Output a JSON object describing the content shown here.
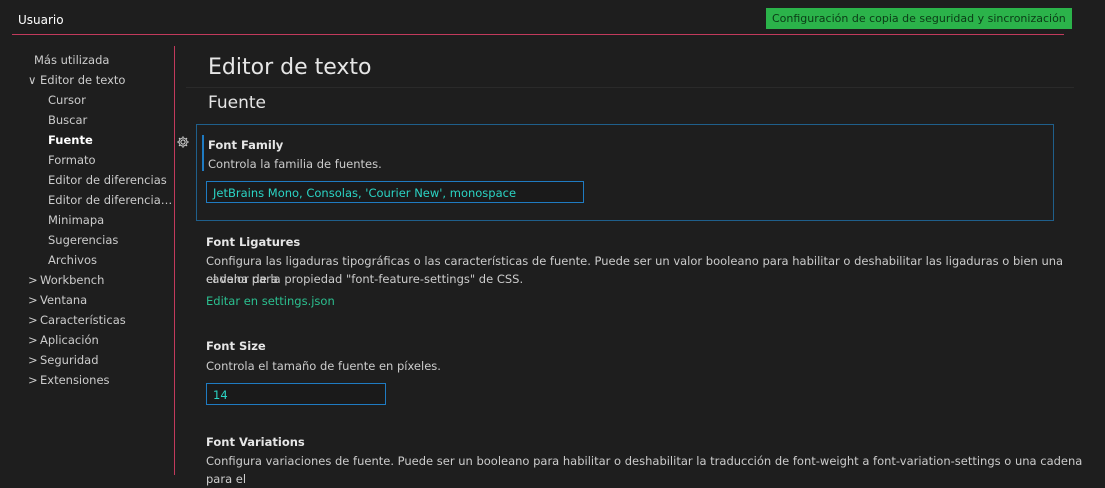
{
  "header": {
    "scope_tab": "Usuario",
    "sync_button": "Configuración de copia de seguridad y sincronización"
  },
  "toc": [
    {
      "label": "Más utilizada",
      "chevron": ""
    },
    {
      "label": "Editor de texto",
      "chevron": "∨"
    },
    {
      "label": "Cursor",
      "chevron": ""
    },
    {
      "label": "Buscar",
      "chevron": ""
    },
    {
      "label": "Fuente",
      "chevron": ""
    },
    {
      "label": "Formato",
      "chevron": ""
    },
    {
      "label": "Editor de diferencias",
      "chevron": ""
    },
    {
      "label": "Editor de diferencias d...",
      "chevron": ""
    },
    {
      "label": "Minimapa",
      "chevron": ""
    },
    {
      "label": "Sugerencias",
      "chevron": ""
    },
    {
      "label": "Archivos",
      "chevron": ""
    },
    {
      "label": "Workbench",
      "chevron": ">"
    },
    {
      "label": "Ventana",
      "chevron": ">"
    },
    {
      "label": "Características",
      "chevron": ">"
    },
    {
      "label": "Aplicación",
      "chevron": ">"
    },
    {
      "label": "Seguridad",
      "chevron": ">"
    },
    {
      "label": "Extensiones",
      "chevron": ">"
    }
  ],
  "main": {
    "title": "Editor de texto",
    "section": "Fuente",
    "font_family": {
      "title": "Font Family",
      "description": "Controla la familia de fuentes.",
      "value": "JetBrains Mono, Consolas, 'Courier New', monospace"
    },
    "font_ligatures": {
      "title": "Font Ligatures",
      "description_line1": "Configura las ligaduras tipográficas o las características de fuente. Puede ser un valor booleano para habilitar o deshabilitar las ligaduras o bien una cadena para",
      "description_line2": "el valor de la propiedad \"font-feature-settings\" de CSS.",
      "link": "Editar en settings.json"
    },
    "font_size": {
      "title": "Font Size",
      "description": "Controla el tamaño de fuente en píxeles.",
      "value": "14"
    },
    "font_variations": {
      "title": "Font Variations",
      "description_line1": "Configura variaciones de fuente. Puede ser un booleano para habilitar o deshabilitar la traducción de font-weight a font-variation-settings o una cadena para el"
    }
  },
  "colors": {
    "accent": "#c23a5c",
    "focus_border": "#1f7bc2",
    "sync_green": "#2bb34a",
    "link": "#2bbf8f"
  }
}
